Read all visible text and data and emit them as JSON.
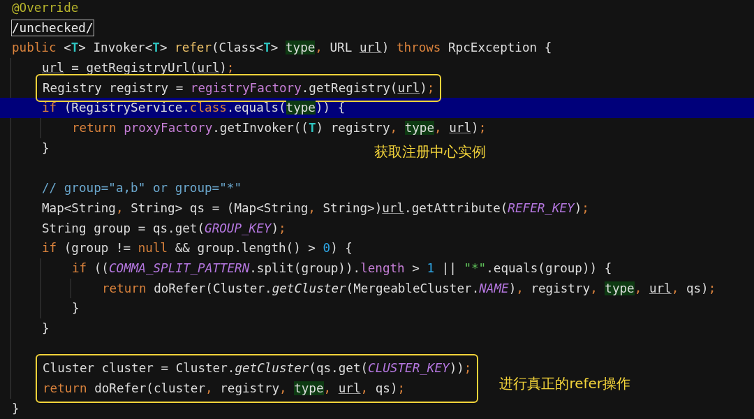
{
  "code": [
    {
      "kind": "line",
      "current": false,
      "tokens": [
        {
          "kind": "ann",
          "text": "@Override"
        }
      ]
    },
    {
      "kind": "line",
      "current": false,
      "tokens": [
        {
          "kind": "folded",
          "text": "/unchecked/"
        }
      ]
    },
    {
      "kind": "line",
      "current": false,
      "tokens": [
        {
          "kind": "kw",
          "text": "public"
        },
        {
          "kind": "plain",
          "text": " <"
        },
        {
          "kind": "tp",
          "text": "T"
        },
        {
          "kind": "plain",
          "text": "> Invoker<"
        },
        {
          "kind": "tp",
          "text": "T"
        },
        {
          "kind": "plain",
          "text": "> "
        },
        {
          "kind": "decl",
          "text": "refer"
        },
        {
          "kind": "plain",
          "text": "(Class<"
        },
        {
          "kind": "tp",
          "text": "T"
        },
        {
          "kind": "plain",
          "text": "> "
        },
        {
          "kind": "param",
          "text": "type"
        },
        {
          "kind": "punct",
          "text": ", "
        },
        {
          "kind": "plain",
          "text": "URL "
        },
        {
          "kind": "ul",
          "text": "url"
        },
        {
          "kind": "plain",
          "text": ") "
        },
        {
          "kind": "kw",
          "text": "throws"
        },
        {
          "kind": "plain",
          "text": " RpcException {"
        }
      ],
      "children": [
        {
          "kind": "line",
          "current": false,
          "tokens": [
            {
              "kind": "ul",
              "text": "url"
            },
            {
              "kind": "plain",
              "text": " = getRegistryUrl("
            },
            {
              "kind": "ul",
              "text": "url"
            },
            {
              "kind": "plain",
              "text": ")"
            },
            {
              "kind": "punct",
              "text": ";"
            }
          ]
        },
        {
          "kind": "callout",
          "lines": [
            {
              "kind": "line",
              "current": false,
              "tokens": [
                {
                  "kind": "plain",
                  "text": "Registry registry = "
                },
                {
                  "kind": "field",
                  "text": "registryFactory"
                },
                {
                  "kind": "plain",
                  "text": ".getRegistry("
                },
                {
                  "kind": "ul",
                  "text": "url"
                },
                {
                  "kind": "plain",
                  "text": ")"
                },
                {
                  "kind": "punct",
                  "text": ";"
                }
              ]
            }
          ]
        },
        {
          "kind": "line",
          "current": true,
          "tokens": [
            {
              "kind": "kw",
              "text": "if"
            },
            {
              "kind": "plain",
              "text": " (RegistryService."
            },
            {
              "kind": "kw",
              "text": "class"
            },
            {
              "kind": "plain",
              "text": ".equals("
            },
            {
              "kind": "param",
              "text": "type"
            },
            {
              "kind": "plain",
              "text": ")) {"
            }
          ],
          "children": [
            {
              "kind": "line",
              "current": false,
              "tokens": [
                {
                  "kind": "kw",
                  "text": "return "
                },
                {
                  "kind": "field",
                  "text": "proxyFactory"
                },
                {
                  "kind": "plain",
                  "text": ".getInvoker(("
                },
                {
                  "kind": "tp",
                  "text": "T"
                },
                {
                  "kind": "plain",
                  "text": ") registry"
                },
                {
                  "kind": "punct",
                  "text": ", "
                },
                {
                  "kind": "param",
                  "text": "type"
                },
                {
                  "kind": "punct",
                  "text": ", "
                },
                {
                  "kind": "ul",
                  "text": "url"
                },
                {
                  "kind": "plain",
                  "text": ")"
                },
                {
                  "kind": "punct",
                  "text": ";"
                }
              ]
            }
          ]
        },
        {
          "kind": "line",
          "current": false,
          "note": "获取注册中心实例",
          "tokens": [
            {
              "kind": "plain",
              "text": "}"
            }
          ]
        },
        {
          "kind": "blank"
        },
        {
          "kind": "line",
          "current": false,
          "tokens": [
            {
              "kind": "comment",
              "text": "// group=\"a,b\" or group=\"*\""
            }
          ]
        },
        {
          "kind": "line",
          "current": false,
          "tokens": [
            {
              "kind": "plain",
              "text": "Map<String"
            },
            {
              "kind": "punct",
              "text": ", "
            },
            {
              "kind": "plain",
              "text": "String> qs = (Map<String"
            },
            {
              "kind": "punct",
              "text": ", "
            },
            {
              "kind": "plain",
              "text": "String>)"
            },
            {
              "kind": "ul",
              "text": "url"
            },
            {
              "kind": "plain",
              "text": ".getAttribute("
            },
            {
              "kind": "const",
              "text": "REFER_KEY"
            },
            {
              "kind": "plain",
              "text": ")"
            },
            {
              "kind": "punct",
              "text": ";"
            }
          ]
        },
        {
          "kind": "line",
          "current": false,
          "tokens": [
            {
              "kind": "plain",
              "text": "String group = qs.get("
            },
            {
              "kind": "const",
              "text": "GROUP_KEY"
            },
            {
              "kind": "plain",
              "text": ")"
            },
            {
              "kind": "punct",
              "text": ";"
            }
          ]
        },
        {
          "kind": "line",
          "current": false,
          "tokens": [
            {
              "kind": "kw",
              "text": "if"
            },
            {
              "kind": "plain",
              "text": " (group != "
            },
            {
              "kind": "kw",
              "text": "null"
            },
            {
              "kind": "plain",
              "text": " && group.length() > "
            },
            {
              "kind": "num",
              "text": "0"
            },
            {
              "kind": "plain",
              "text": ") {"
            }
          ],
          "children": [
            {
              "kind": "line",
              "current": false,
              "tokens": [
                {
                  "kind": "kw",
                  "text": "if"
                },
                {
                  "kind": "plain",
                  "text": " (("
                },
                {
                  "kind": "const",
                  "text": "COMMA_SPLIT_PATTERN"
                },
                {
                  "kind": "plain",
                  "text": ".split(group))."
                },
                {
                  "kind": "field",
                  "text": "length"
                },
                {
                  "kind": "plain",
                  "text": " > "
                },
                {
                  "kind": "num",
                  "text": "1"
                },
                {
                  "kind": "plain",
                  "text": " || "
                },
                {
                  "kind": "str",
                  "text": "\"*\""
                },
                {
                  "kind": "plain",
                  "text": ".equals(group)) {"
                }
              ],
              "children": [
                {
                  "kind": "line",
                  "current": false,
                  "tokens": [
                    {
                      "kind": "kw",
                      "text": "return "
                    },
                    {
                      "kind": "plain",
                      "text": "doRefer(Cluster."
                    },
                    {
                      "kind": "static",
                      "text": "getCluster"
                    },
                    {
                      "kind": "plain",
                      "text": "(MergeableCluster."
                    },
                    {
                      "kind": "const",
                      "text": "NAME"
                    },
                    {
                      "kind": "plain",
                      "text": ")"
                    },
                    {
                      "kind": "punct",
                      "text": ", "
                    },
                    {
                      "kind": "plain",
                      "text": "registry"
                    },
                    {
                      "kind": "punct",
                      "text": ", "
                    },
                    {
                      "kind": "param",
                      "text": "type"
                    },
                    {
                      "kind": "punct",
                      "text": ", "
                    },
                    {
                      "kind": "ul",
                      "text": "url"
                    },
                    {
                      "kind": "punct",
                      "text": ", "
                    },
                    {
                      "kind": "plain",
                      "text": "qs)"
                    },
                    {
                      "kind": "punct",
                      "text": ";"
                    }
                  ]
                }
              ]
            },
            {
              "kind": "line",
              "current": false,
              "tokens": [
                {
                  "kind": "plain",
                  "text": "}"
                }
              ]
            }
          ]
        },
        {
          "kind": "line",
          "current": false,
          "tokens": [
            {
              "kind": "plain",
              "text": "}"
            }
          ]
        },
        {
          "kind": "blank"
        },
        {
          "kind": "callout",
          "note": "进行真正的refer操作",
          "lines": [
            {
              "kind": "line",
              "current": false,
              "tokens": [
                {
                  "kind": "plain",
                  "text": "Cluster cluster = Cluster."
                },
                {
                  "kind": "static",
                  "text": "getCluster"
                },
                {
                  "kind": "plain",
                  "text": "(qs.get("
                },
                {
                  "kind": "const",
                  "text": "CLUSTER_KEY"
                },
                {
                  "kind": "plain",
                  "text": "))"
                },
                {
                  "kind": "punct",
                  "text": ";"
                }
              ]
            },
            {
              "kind": "line",
              "current": false,
              "tokens": [
                {
                  "kind": "kw",
                  "text": "return "
                },
                {
                  "kind": "plain",
                  "text": "doRefer(cluster"
                },
                {
                  "kind": "punct",
                  "text": ", "
                },
                {
                  "kind": "plain",
                  "text": "registry"
                },
                {
                  "kind": "punct",
                  "text": ", "
                },
                {
                  "kind": "param",
                  "text": "type"
                },
                {
                  "kind": "punct",
                  "text": ", "
                },
                {
                  "kind": "ul",
                  "text": "url"
                },
                {
                  "kind": "punct",
                  "text": ", "
                },
                {
                  "kind": "plain",
                  "text": "qs)"
                },
                {
                  "kind": "punct",
                  "text": ";"
                }
              ]
            }
          ]
        }
      ]
    },
    {
      "kind": "line",
      "current": false,
      "tokens": [
        {
          "kind": "plain",
          "text": "}"
        }
      ]
    }
  ]
}
